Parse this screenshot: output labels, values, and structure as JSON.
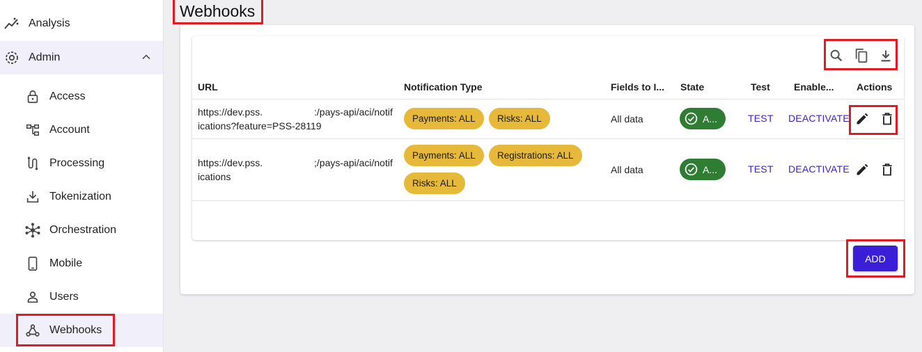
{
  "sidebar": {
    "analysis": "Analysis",
    "admin": "Admin",
    "items": [
      {
        "label": "Access"
      },
      {
        "label": "Account"
      },
      {
        "label": "Processing"
      },
      {
        "label": "Tokenization"
      },
      {
        "label": "Orchestration"
      },
      {
        "label": "Mobile"
      },
      {
        "label": "Users"
      },
      {
        "label": "Webhooks"
      }
    ]
  },
  "page": {
    "title": "Webhooks"
  },
  "table": {
    "columns": [
      "URL",
      "Notification Type",
      "Fields to I...",
      "State",
      "Test",
      "Enable...",
      "Actions"
    ],
    "rows": [
      {
        "url_line1": "https://dev.pss.                   :/pays-api/aci/notif",
        "url_line2": "ications?feature=PSS-28119",
        "chips": [
          "Payments: ALL",
          "Risks: ALL"
        ],
        "fields": "All data",
        "state": "A...",
        "test": "TEST",
        "enable": "DEACTIVATE"
      },
      {
        "url_line1": "https://dev.pss.                   ;/pays-api/aci/notif",
        "url_line2": "ications",
        "chips": [
          "Payments: ALL",
          "Registrations: ALL",
          "Risks: ALL"
        ],
        "fields": "All data",
        "state": "A...",
        "test": "TEST",
        "enable": "DEACTIVATE"
      }
    ]
  },
  "add_label": "ADD",
  "colors": {
    "accent": "#3a1fd6",
    "chip": "#e7b93a",
    "state": "#2e7d32",
    "highlight": "#e01b24"
  }
}
